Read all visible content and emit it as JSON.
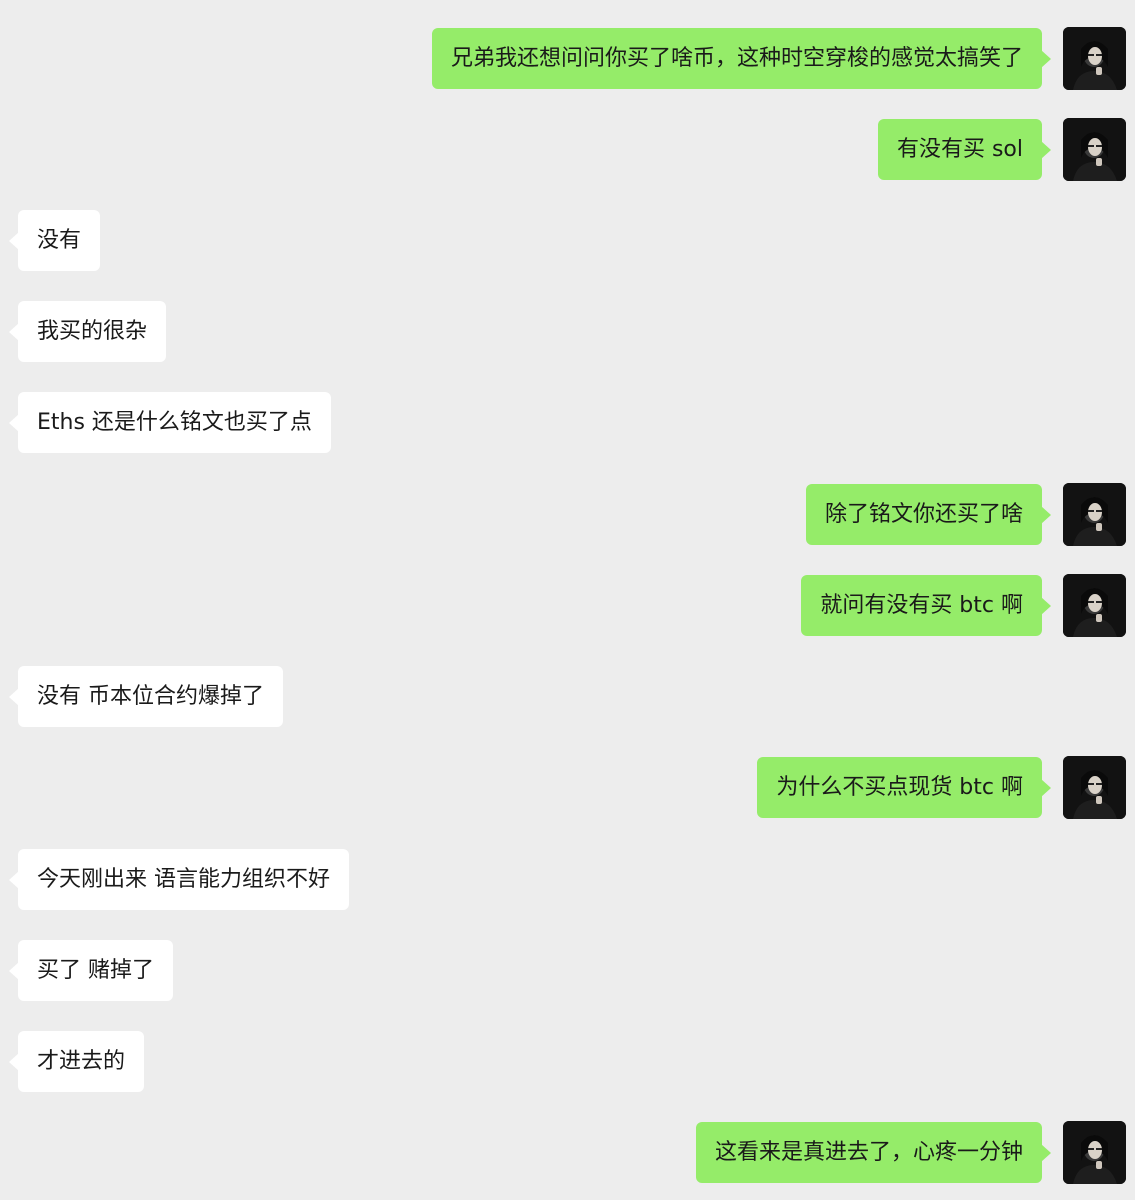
{
  "conversation": {
    "messages": [
      {
        "side": "out",
        "text": "兄弟我还想问问你买了啥币，这种时空穿梭的感觉太搞笑了"
      },
      {
        "side": "out",
        "text": "有没有买 sol"
      },
      {
        "side": "in",
        "text": "没有"
      },
      {
        "side": "in",
        "text": "我买的很杂"
      },
      {
        "side": "in",
        "text": "Eths 还是什么铭文也买了点"
      },
      {
        "side": "out",
        "text": "除了铭文你还买了啥"
      },
      {
        "side": "out",
        "text": "就问有没有买 btc 啊"
      },
      {
        "side": "in",
        "text": "没有 币本位合约爆掉了"
      },
      {
        "side": "out",
        "text": "为什么不买点现货 btc 啊"
      },
      {
        "side": "in",
        "text": "今天刚出来 语言能力组织不好"
      },
      {
        "side": "in",
        "text": "买了 赌掉了"
      },
      {
        "side": "in",
        "text": "才进去的"
      },
      {
        "side": "out",
        "text": "这看来是真进去了，心疼一分钟"
      }
    ]
  },
  "colors": {
    "background": "#ededed",
    "outgoing_bubble": "#95ec69",
    "incoming_bubble": "#ffffff",
    "text": "#1a1a1a"
  },
  "icons": {
    "avatar": "user-avatar-photo"
  }
}
